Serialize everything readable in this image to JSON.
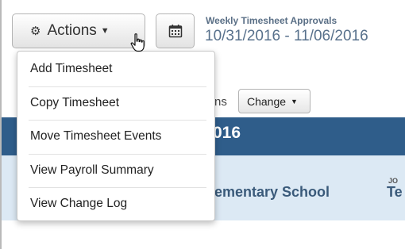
{
  "toolbar": {
    "actions_label": "Actions",
    "actions_icon": "gear-icon",
    "calendar_icon": "calendar-icon"
  },
  "header": {
    "title": "Weekly Timesheet Approvals",
    "date_range": "10/31/2016 - 11/06/2016"
  },
  "actions_menu": {
    "items": [
      {
        "label": "Add Timesheet"
      },
      {
        "label": "Copy Timesheet"
      },
      {
        "label": "Move Timesheet Events"
      },
      {
        "label": "View Payroll Summary"
      },
      {
        "label": "View Change Log"
      }
    ]
  },
  "background": {
    "partial_label": "ns",
    "change_label": "Change",
    "band_text": "016",
    "school_text": "lementary School",
    "column_label": "JO",
    "column_value": "Te"
  },
  "colors": {
    "header_band": "#2f5d8a",
    "subheader_band": "#dce9f4",
    "title_text": "#5a6f86"
  }
}
